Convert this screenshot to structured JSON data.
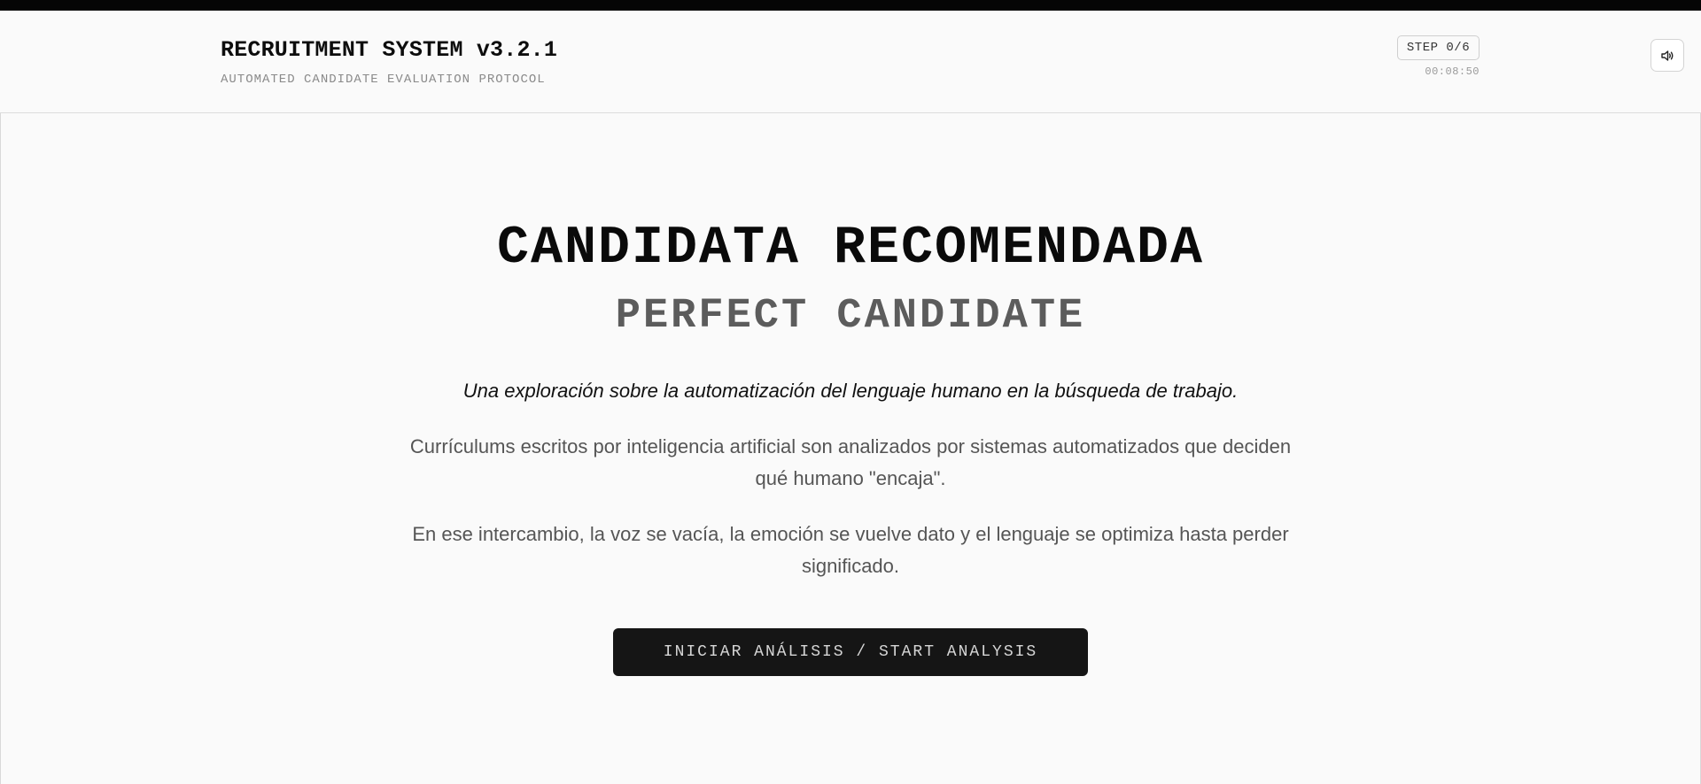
{
  "header": {
    "title": "RECRUITMENT SYSTEM v3.2.1",
    "subtitle": "AUTOMATED CANDIDATE EVALUATION PROTOCOL",
    "step": "STEP 0/6",
    "timer": "00:08:50",
    "sound_icon": "speaker-icon"
  },
  "hero": {
    "headline": "CANDIDATA RECOMENDADA",
    "subheadline": "PERFECT CANDIDATE",
    "intro": "Una exploración sobre la automatización del lenguaje humano en la búsqueda de trabajo.",
    "paragraph1": "Currículums escritos por inteligencia artificial son analizados por sistemas automatizados que deciden qué humano \"encaja\".",
    "paragraph2": "En ese intercambio, la voz se vacía, la emoción se vuelve dato y el lenguaje se optimiza hasta perder significado.",
    "cta_label": "INICIAR ANÁLISIS / START ANALYSIS"
  }
}
